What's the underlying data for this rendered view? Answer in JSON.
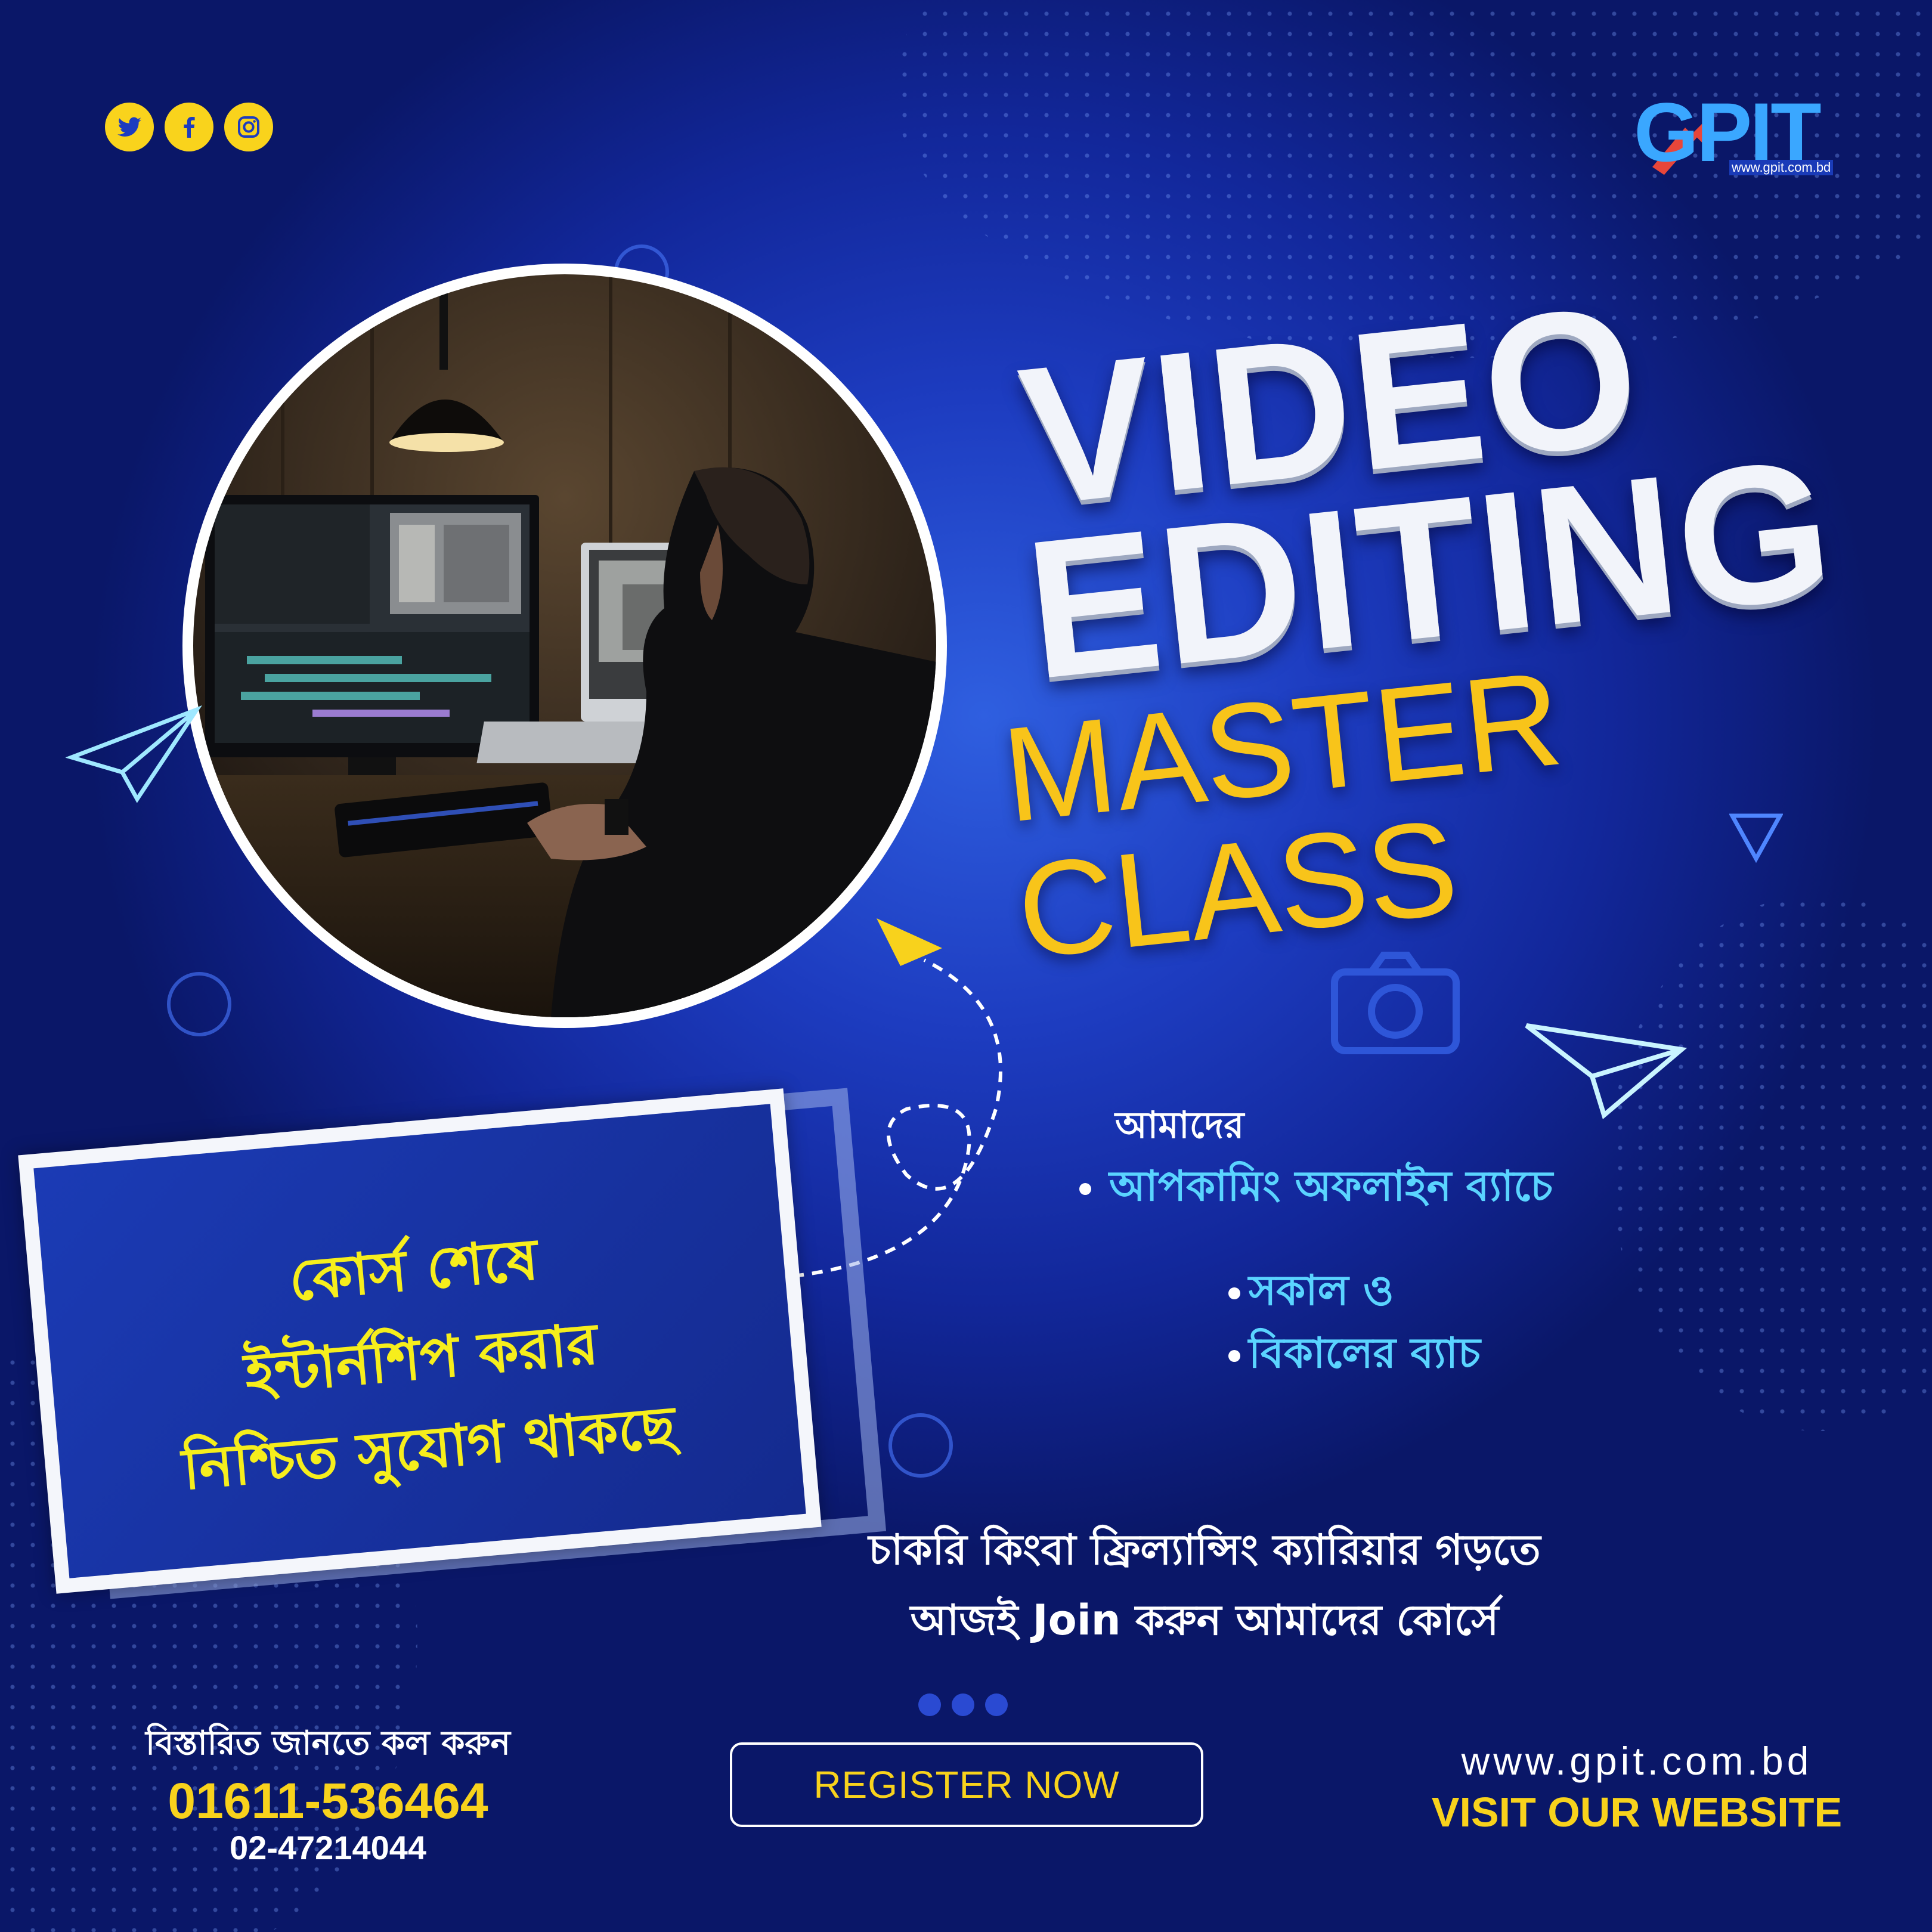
{
  "social": {
    "icons": [
      "twitter-icon",
      "facebook-icon",
      "instagram-icon"
    ],
    "color": "#f9d31c"
  },
  "logo": {
    "g": "G",
    "pit": "PIT",
    "url": "www.gpit.com.bd"
  },
  "headline": {
    "line1": "VIDEO",
    "line2": "EDITING",
    "line3": "MASTER CLASS"
  },
  "internship_box": {
    "line1": "কোর্স শেষে",
    "line2": "ইন্টার্নশিপ করার",
    "line3": "নিশ্চিত সুযোগ থাকছে"
  },
  "batch_info": {
    "title": "আমাদের",
    "upcoming": "আপকামিং অফলাইন ব্যাচে",
    "morning": "সকাল ও",
    "afternoon": "বিকালের ব্যাচ"
  },
  "cta": {
    "line1": "চাকরি কিংবা ফ্রিল্যান্সিং ক্যারিয়ার গড়তে",
    "line2": "আজই Join করুন আমাদের কোর্সে"
  },
  "contact": {
    "label": "বিস্তারিত জানতে কল করুন",
    "phone1": "01611-536464",
    "phone2": "02-47214044"
  },
  "register_button": "REGISTER NOW",
  "website": {
    "url": "www.gpit.com.bd",
    "cta": "VISIT OUR WEBSITE"
  },
  "colors": {
    "background": "#1d3cc0",
    "accent_yellow": "#f8d21c",
    "accent_cyan": "#5ad4ff",
    "box_text": "#f6ee1c"
  }
}
